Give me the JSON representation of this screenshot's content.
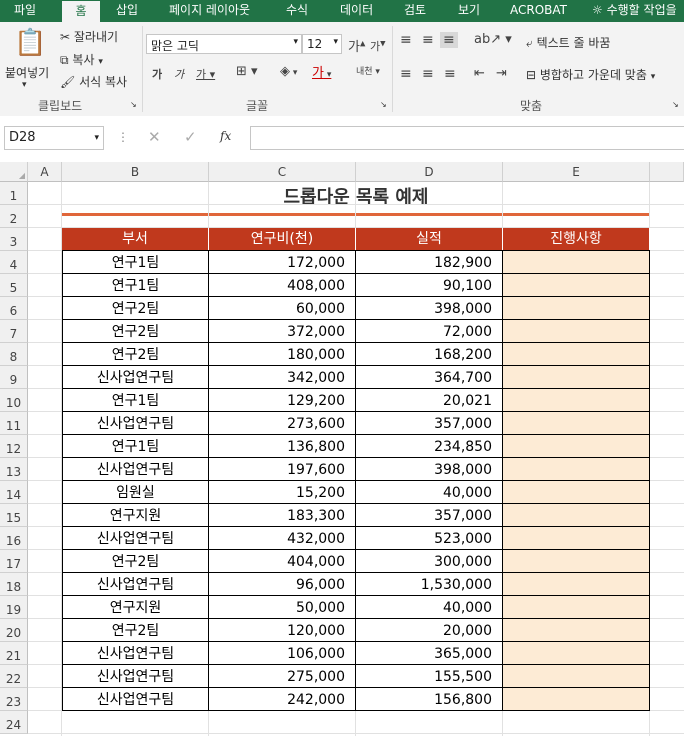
{
  "ribbon": {
    "tabs": [
      "파일",
      "홈",
      "삽입",
      "페이지 레이아웃",
      "수식",
      "데이터",
      "검토",
      "보기",
      "ACROBAT",
      "수행할 작업을"
    ],
    "active_tab": "홈",
    "clipboard": {
      "paste": "붙여넣기",
      "cut": "잘라내기",
      "copy": "복사",
      "format_painter": "서식 복사",
      "group": "클립보드"
    },
    "font": {
      "name": "맑은 고딕",
      "size": "12",
      "group": "글꼴"
    },
    "alignment": {
      "wrap_text": "텍스트 줄 바꿈",
      "merge_center": "병합하고 가운데 맞춤",
      "group": "맞춤"
    },
    "colors": {
      "accent": "#217346"
    }
  },
  "formula_bar": {
    "name_box": "D28",
    "fx": "fx",
    "value": ""
  },
  "sheet": {
    "columns": [
      "A",
      "B",
      "C",
      "D",
      "E"
    ],
    "rows": [
      "1",
      "2",
      "3",
      "4",
      "5",
      "6",
      "7",
      "8",
      "9",
      "10",
      "11",
      "12",
      "13",
      "14",
      "15",
      "16",
      "17",
      "18",
      "19",
      "20",
      "21",
      "22",
      "23",
      "24"
    ],
    "title": "드롭다운 목록 예제",
    "headers": [
      "부서",
      "연구비(천)",
      "실적",
      "진행사항"
    ],
    "data": [
      [
        "연구1팀",
        "172,000",
        "182,900"
      ],
      [
        "연구1팀",
        "408,000",
        "90,100"
      ],
      [
        "연구2팀",
        "60,000",
        "398,000"
      ],
      [
        "연구2팀",
        "372,000",
        "72,000"
      ],
      [
        "연구2팀",
        "180,000",
        "168,200"
      ],
      [
        "신사업연구팀",
        "342,000",
        "364,700"
      ],
      [
        "연구1팀",
        "129,200",
        "20,021"
      ],
      [
        "신사업연구팀",
        "273,600",
        "357,000"
      ],
      [
        "연구1팀",
        "136,800",
        "234,850"
      ],
      [
        "신사업연구팀",
        "197,600",
        "398,000"
      ],
      [
        "임원실",
        "15,200",
        "40,000"
      ],
      [
        "연구지원",
        "183,300",
        "357,000"
      ],
      [
        "신사업연구팀",
        "432,000",
        "523,000"
      ],
      [
        "연구2팀",
        "404,000",
        "300,000"
      ],
      [
        "신사업연구팀",
        "96,000",
        "1,530,000"
      ],
      [
        "연구지원",
        "50,000",
        "40,000"
      ],
      [
        "연구2팀",
        "120,000",
        "20,000"
      ],
      [
        "신사업연구팀",
        "106,000",
        "365,000"
      ],
      [
        "신사업연구팀",
        "275,000",
        "155,500"
      ],
      [
        "신사업연구팀",
        "242,000",
        "156,800"
      ]
    ],
    "colors": {
      "header_bg": "#c0391d",
      "title_line": "#e0663a",
      "status_fill": "#fdebd5"
    }
  }
}
